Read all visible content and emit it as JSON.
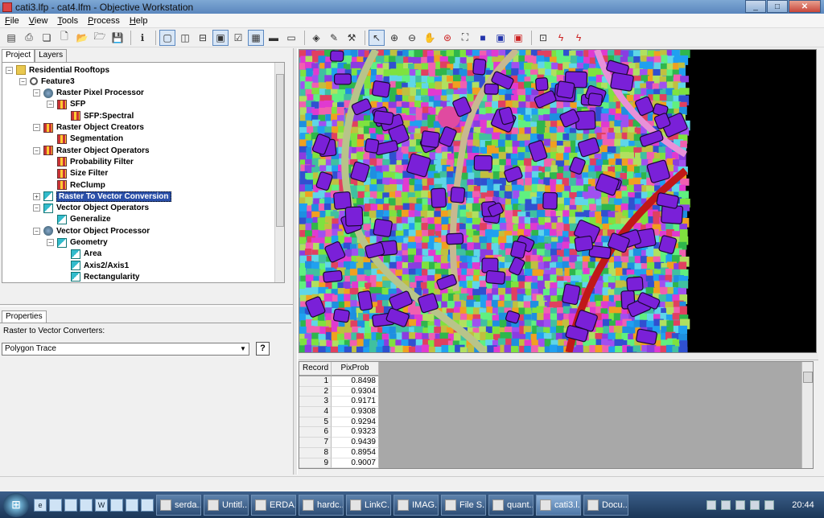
{
  "window": {
    "title": "cati3.lfp - cat4.lfm - Objective Workstation",
    "buttons": {
      "minimize": "_",
      "maximize": "□",
      "close": "✕"
    }
  },
  "menu": [
    "File",
    "View",
    "Tools",
    "Process",
    "Help"
  ],
  "toolbar": {
    "groups": [
      [
        "panel-icon",
        "print-icon",
        "layers-icon",
        "new-icon",
        "open-icon",
        "open-project-icon",
        "save-icon"
      ],
      [
        "info-icon"
      ],
      [
        "single-view-icon",
        "split-vertical-icon",
        "split-horizontal-icon",
        "toggle-view-icon",
        "check-icon",
        "table-icon",
        "line-icon",
        "image-icon"
      ],
      [
        "layer-add-icon",
        "eraser-icon",
        "hammer-icon"
      ],
      [
        "pointer-icon",
        "zoom-in-icon",
        "zoom-out-icon",
        "pan-icon",
        "rotate-icon",
        "fit-icon",
        "stop-icon",
        "blue-box-icon",
        "red-box-icon"
      ],
      [
        "target-icon",
        "flash-icon",
        "flash2-icon"
      ]
    ]
  },
  "left_panel": {
    "tabs": [
      "Project",
      "Layers"
    ],
    "active_tab": "Project",
    "tree": [
      {
        "label": "Residential Rooftops",
        "level": 0,
        "expander": "−",
        "icon": "folder"
      },
      {
        "label": "Feature3",
        "level": 1,
        "expander": "−",
        "icon": "mag"
      },
      {
        "label": "Raster Pixel Processor",
        "level": 2,
        "expander": "−",
        "icon": "globe"
      },
      {
        "label": "SFP",
        "level": 3,
        "expander": "−",
        "icon": "grid"
      },
      {
        "label": "SFP:Spectral",
        "level": 4,
        "expander": "",
        "icon": "grid"
      },
      {
        "label": "Raster Object Creators",
        "level": 2,
        "expander": "−",
        "icon": "grid"
      },
      {
        "label": "Segmentation",
        "level": 3,
        "expander": "",
        "icon": "grid"
      },
      {
        "label": "Raster Object Operators",
        "level": 2,
        "expander": "−",
        "icon": "grid"
      },
      {
        "label": "Probability Filter",
        "level": 3,
        "expander": "",
        "icon": "grid"
      },
      {
        "label": "Size Filter",
        "level": 3,
        "expander": "",
        "icon": "grid"
      },
      {
        "label": "ReClump",
        "level": 3,
        "expander": "",
        "icon": "grid"
      },
      {
        "label": "Raster To Vector Conversion",
        "level": 2,
        "expander": "+",
        "icon": "vec",
        "selected": true
      },
      {
        "label": "Vector Object Operators",
        "level": 2,
        "expander": "−",
        "icon": "vec"
      },
      {
        "label": "Generalize",
        "level": 3,
        "expander": "",
        "icon": "vec"
      },
      {
        "label": "Vector Object Processor",
        "level": 2,
        "expander": "−",
        "icon": "globe"
      },
      {
        "label": "Geometry",
        "level": 3,
        "expander": "−",
        "icon": "vec"
      },
      {
        "label": "Area",
        "level": 4,
        "expander": "",
        "icon": "vec"
      },
      {
        "label": "Axis2/Axis1",
        "level": 4,
        "expander": "",
        "icon": "vec"
      },
      {
        "label": "Rectangularity",
        "level": 4,
        "expander": "",
        "icon": "vec"
      }
    ]
  },
  "properties": {
    "tab": "Properties",
    "label": "Raster to Vector Converters:",
    "selected": "Polygon Trace",
    "help": "?"
  },
  "table": {
    "columns": [
      "Record",
      "PixProb"
    ],
    "rows": [
      [
        "1",
        "0.8498"
      ],
      [
        "2",
        "0.9304"
      ],
      [
        "3",
        "0.9171"
      ],
      [
        "4",
        "0.9308"
      ],
      [
        "5",
        "0.9294"
      ],
      [
        "6",
        "0.9323"
      ],
      [
        "7",
        "0.9439"
      ],
      [
        "8",
        "0.8954"
      ],
      [
        "9",
        "0.9007"
      ]
    ]
  },
  "taskbar": {
    "start": "⊞",
    "buttons": [
      "serda...",
      "Untitl...",
      "ERDA...",
      "hardc...",
      "LinkC...",
      "IMAG...",
      "File S...",
      "quant...",
      "cati3.l...",
      "Docu..."
    ],
    "active": "cati3.l...",
    "clock": "20:44"
  }
}
